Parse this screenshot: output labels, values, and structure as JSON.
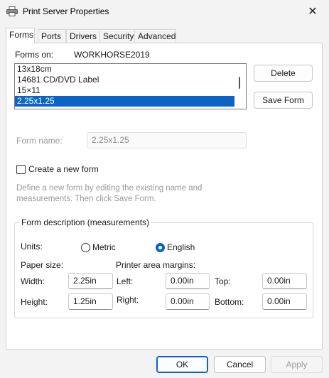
{
  "window": {
    "title": "Print Server Properties",
    "icon": "printer-icon"
  },
  "tabs": [
    {
      "label": "Forms",
      "active": true
    },
    {
      "label": "Ports",
      "active": false
    },
    {
      "label": "Drivers",
      "active": false
    },
    {
      "label": "Security",
      "active": false
    },
    {
      "label": "Advanced",
      "active": false
    }
  ],
  "forms_on": {
    "label": "Forms on:",
    "server": "WORKHORSE2019"
  },
  "forms_list": {
    "items": [
      "13x18cm",
      "14681 CD/DVD Label",
      "15×11",
      "2.25x1.25"
    ],
    "selected_index": 3
  },
  "buttons": {
    "delete": "Delete",
    "save_form": "Save Form",
    "ok": "OK",
    "cancel": "Cancel",
    "apply": "Apply"
  },
  "form_name": {
    "label": "Form name:",
    "value": "2.25x1.25"
  },
  "create_new": {
    "label": "Create a new form",
    "checked": false,
    "help_line1": "Define a new form by editing the existing name and",
    "help_line2": "measurements. Then click Save Form."
  },
  "description": {
    "group_label": "Form description (measurements)",
    "units_label": "Units:",
    "metric_label": "Metric",
    "english_label": "English",
    "selected_unit": "English",
    "paper_size_label": "Paper size:",
    "margins_label": "Printer area margins:",
    "width_label": "Width:",
    "width_value": "2.25in",
    "height_label": "Height:",
    "height_value": "1.25in",
    "left_label": "Left:",
    "left_value": "0.00in",
    "right_label": "Right:",
    "right_value": "0.00in",
    "top_label": "Top:",
    "top_value": "0.00in",
    "bottom_label": "Bottom:",
    "bottom_value": "0.00in"
  },
  "colors": {
    "accent": "#0a64c8",
    "window_bg": "#f3f3f3",
    "panel_bg": "#ffffff"
  }
}
